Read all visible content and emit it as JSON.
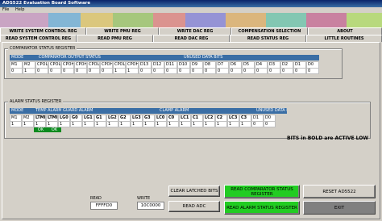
{
  "window": {
    "title": "ADS522 Evaluation Board Software"
  },
  "menu": [
    "File",
    "Help"
  ],
  "tabs_row1": [
    "WRITE SYSTEM CONTROL REG",
    "WRITE PMU REG",
    "WRITE DAC REG",
    "COMPENSATION SELECTION",
    "ABOUT"
  ],
  "tabs_row2": [
    "READ SYSTEM CONTROL REG",
    "READ PMU REG",
    "READ DAC REG",
    "READ STATUS REG",
    "LITTLE ROUTINES"
  ],
  "comparator": {
    "title": "COMPARATOR STATUS REGISTER",
    "mode_header": "MODE",
    "output_header": "COMPARATOR OUTPUT STATUS",
    "unused_header": "UNUSED DATA BITS",
    "labels": [
      "M1",
      "M2",
      "CPOL0",
      "CPOL1",
      "CPOH1",
      "CPOH1",
      "CPOL2",
      "CPOH2",
      "CPOL3",
      "CPOH3",
      "D13",
      "D12",
      "D11",
      "D10",
      "D9",
      "D8",
      "D7",
      "D6",
      "D5",
      "D4",
      "D3",
      "D2",
      "D1",
      "D0"
    ],
    "values": [
      "0",
      "1",
      "0",
      "0",
      "0",
      "0",
      "0",
      "0",
      "1",
      "1",
      "0",
      "0",
      "0",
      "0",
      "0",
      "0",
      "0",
      "0",
      "0",
      "0",
      "0",
      "0",
      "0",
      "0"
    ]
  },
  "alarm": {
    "title": "ALARM STATUS REGISTER",
    "mode_header": "MODE",
    "temp_header": "TEMP ALARM",
    "guard_header": "GUARD ALARM",
    "clamp_header": "CLAMP ALARM",
    "unused_header": "UNUSED DATA BITS",
    "labels": [
      "M1",
      "M2",
      "LTMP",
      "LTMP",
      "LG0",
      "G0",
      "LG1",
      "G1",
      "LG2",
      "G2",
      "LG3",
      "G3",
      "LC0",
      "C0",
      "LC1",
      "C1",
      "LC2",
      "C2",
      "LC3",
      "C3",
      "D1",
      "D0"
    ],
    "bold": [
      false,
      false,
      true,
      true,
      true,
      true,
      true,
      true,
      true,
      true,
      true,
      true,
      true,
      true,
      true,
      true,
      true,
      true,
      true,
      true,
      false,
      false
    ],
    "values": [
      "1",
      "1",
      "1",
      "1",
      "1",
      "1",
      "1",
      "1",
      "1",
      "1",
      "1",
      "1",
      "1",
      "1",
      "1",
      "1",
      "1",
      "1",
      "1",
      "1",
      "0",
      "0"
    ],
    "ok_labels": [
      "OK",
      "OK"
    ]
  },
  "note": "BITS in BOLD are ACTIVE LOW",
  "read": {
    "label": "READ",
    "value": "FFFFD0"
  },
  "write": {
    "label": "WRITE",
    "value": "10C0000"
  },
  "buttons": {
    "clear": "CLEAR LATCHED BITS",
    "read_adc": "READ ADC",
    "read_comparator": "READ COMPARATOR STATUS REGISTER",
    "read_alarm": "READ ALARM STATUS REGISTER",
    "reset": "RESET AD5522",
    "exit": "EXIT"
  },
  "colors": {
    "header_blue": "#3a6ea5",
    "ok_green": "#0b8a1e",
    "button_green": "#22cc22"
  }
}
